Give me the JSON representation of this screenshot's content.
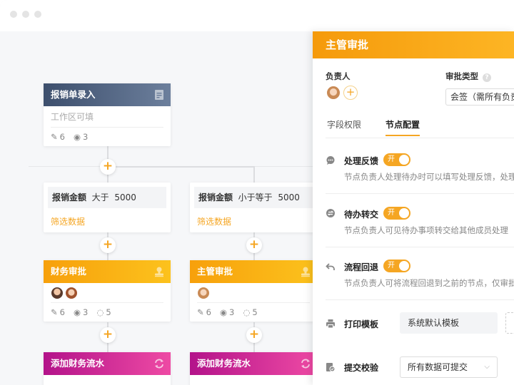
{
  "colors": {
    "accent": "#f5a623",
    "node_dark": "#4a5d7c",
    "node_orange": "#fba90f",
    "node_magenta": "#c91a8e"
  },
  "flow": {
    "start_node": {
      "title": "报销单录入",
      "body": "工作区可填",
      "edit_count": "6",
      "view_count": "3"
    },
    "branch_left": {
      "field": "报销金额",
      "op": "大于",
      "value": "5000",
      "link": "筛选数据"
    },
    "branch_right": {
      "field": "报销金额",
      "op": "小于等于",
      "value": "5000",
      "link": "筛选数据"
    },
    "approval_left": {
      "title": "财务审批",
      "edit_count": "6",
      "view_count": "3",
      "hide_count": "5"
    },
    "approval_right": {
      "title": "主管审批",
      "edit_count": "6",
      "view_count": "3",
      "hide_count": "5"
    },
    "action_left": {
      "title": "添加财务流水"
    },
    "action_right": {
      "title": "添加财务流水"
    },
    "add_symbol": "+"
  },
  "panel": {
    "title": "主管审批",
    "assignee_label": "负责人",
    "approval_type_label": "审批类型",
    "help_symbol": "?",
    "approval_type_value": "会签（需所有负责",
    "tabs": [
      "字段权限",
      "节点配置"
    ],
    "settings": [
      {
        "title": "处理反馈",
        "toggle": "开",
        "desc": "节点负责人处理待办时可以填写处理反馈，处理"
      },
      {
        "title": "待办转交",
        "toggle": "开",
        "desc": "节点负责人可见待办事项转交给其他成员处理"
      },
      {
        "title": "流程回退",
        "toggle": "开",
        "desc": "节点负责人可将流程回退到之前的节点，仅审批"
      }
    ],
    "print_template_label": "打印模板",
    "print_template_value": "系统默认模板",
    "submit_check_label": "提交校验",
    "submit_check_value": "所有数据可提交"
  }
}
